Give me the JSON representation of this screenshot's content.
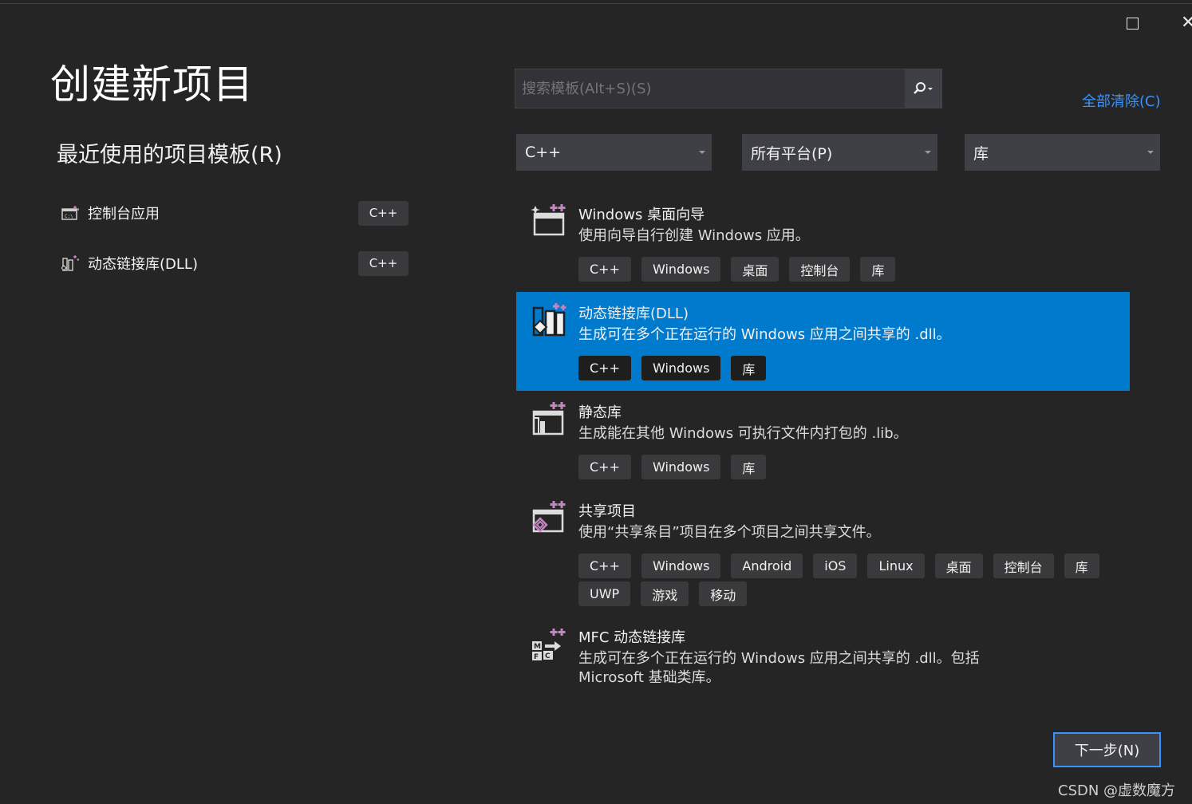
{
  "window": {
    "maximize_icon": "maximize-icon",
    "close_icon": "close-icon"
  },
  "page_title": "创建新项目",
  "recent": {
    "title": "最近使用的项目模板(R)",
    "items": [
      {
        "name": "控制台应用",
        "lang": "C++",
        "icon": "console-app-icon"
      },
      {
        "name": "动态链接库(DLL)",
        "lang": "C++",
        "icon": "dll-icon"
      }
    ]
  },
  "search": {
    "placeholder": "搜索模板(Alt+S)(S)"
  },
  "clear_all": "全部清除(C)",
  "filters": {
    "language": "C++",
    "platform": "所有平台(P)",
    "project_type": "库"
  },
  "templates": [
    {
      "name": "Windows 桌面向导",
      "desc": "使用向导自行创建 Windows 应用。",
      "tags": [
        "C++",
        "Windows",
        "桌面",
        "控制台",
        "库"
      ],
      "selected": false
    },
    {
      "name": "动态链接库(DLL)",
      "desc": "生成可在多个正在运行的 Windows 应用之间共享的 .dll。",
      "tags": [
        "C++",
        "Windows",
        "库"
      ],
      "selected": true
    },
    {
      "name": "静态库",
      "desc": "生成能在其他 Windows 可执行文件内打包的 .lib。",
      "tags": [
        "C++",
        "Windows",
        "库"
      ],
      "selected": false
    },
    {
      "name": "共享项目",
      "desc": "使用“共享条目”项目在多个项目之间共享文件。",
      "tags": [
        "C++",
        "Windows",
        "Android",
        "iOS",
        "Linux",
        "桌面",
        "控制台",
        "库",
        "UWP",
        "游戏",
        "移动"
      ],
      "selected": false
    },
    {
      "name": "MFC 动态链接库",
      "desc": "生成可在多个正在运行的 Windows 应用之间共享的 .dll。包括 Microsoft 基础类库。",
      "tags": [],
      "selected": false
    }
  ],
  "next_button": "下一步(N)",
  "watermark": "CSDN @虚数魔方",
  "colors": {
    "background": "#252526",
    "accent": "#007acc",
    "link": "#3794ff"
  }
}
